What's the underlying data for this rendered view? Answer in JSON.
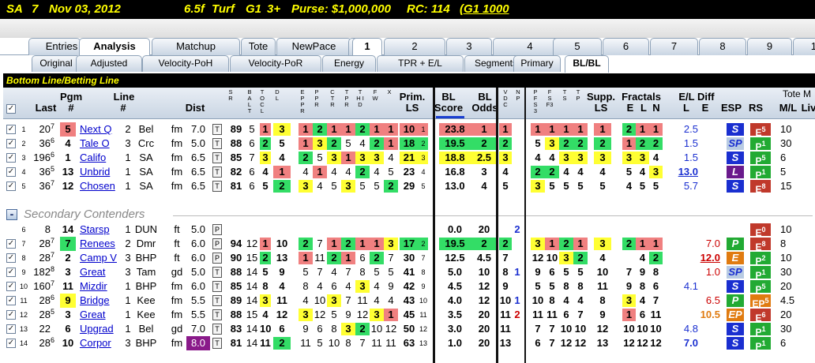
{
  "title": {
    "track": "SA",
    "race": "7",
    "date": "Nov 03, 2012",
    "distance": "6.5f",
    "surface": "Turf",
    "grade": "G1",
    "age": "3+",
    "purse": "Purse: $1,000,000",
    "rc": "RC: 114",
    "rc_suffix": "(G1 1000"
  },
  "tabs_primary": [
    "Entries",
    "Analysis",
    "Matchup",
    "Tote",
    "NewPace",
    "1",
    "2",
    "3",
    "4",
    "5",
    "6",
    "7",
    "8",
    "9",
    "10"
  ],
  "tabs_secondary": [
    "Original",
    "Adjusted",
    "Velocity-PoH",
    "Velocity-PoR",
    "Energy",
    "TPR + E/L",
    "Segments",
    "Primary",
    "BL/BL"
  ],
  "section_title": "Bottom Line/Betting Line",
  "secondary_label": "Secondary Contenders",
  "headers": {
    "last": "Last",
    "pgm": "Pgm",
    "pgm_hash": "#",
    "line": "Line",
    "line_hash": "#",
    "dist": "Dist",
    "sr": "S R",
    "balt": "B A L T",
    "tocl": "T O C L",
    "dl": "D L",
    "epp": "E P P R",
    "ppr": "P P R",
    "ctr": "C T R",
    "tpr": "T P R",
    "thd": "T H I D",
    "fw": "F W",
    "fx": "X",
    "prim": "Prim.",
    "ls": "LS",
    "bl_score": "BL Score",
    "bl_odds": "BL Odds",
    "vdc": "V D C",
    "np": "N P",
    "pfs": "P F S 3",
    "fs": "F S F3",
    "ts": "T S",
    "tp": "T P",
    "supp": "Supp.",
    "sls": "LS",
    "fractals": "Fractals",
    "e": "E",
    "l": "L",
    "n": "N",
    "eldiff": "E/L Diff",
    "el_l": "L",
    "el_e": "E",
    "esp": "ESP",
    "rs": "RS",
    "tote": "Tote M",
    "ml": "M/L",
    "live": "Liv"
  },
  "primary": [
    {
      "i": "1",
      "last": "20",
      "lsup": "7",
      "pgm": "5",
      "name": "Next Q",
      "line": "2",
      "trk": "Bel",
      "sf": "fm",
      "dist": "7.0",
      "tag": "T",
      "sr": "89",
      "b1": "5",
      "b2": "1",
      "b3": "3",
      "e1": "1",
      "e2": "2",
      "e3": "1",
      "e4": "1",
      "e5": "2",
      "e6": "1",
      "e7": "1",
      "e8": "2",
      "prim": "10",
      "pls": "1",
      "score": "23.8",
      "odds": "1",
      "vdc": "1",
      "np": "",
      "s1": "1",
      "s2": "1",
      "s3": "1",
      "s4": "1",
      "supp": "1",
      "fe": "2",
      "fl": "1",
      "fn": "1",
      "el": "2.5",
      "ee": "",
      "esp": "S",
      "rs": "E",
      "rsn": "5",
      "ml": "10",
      "live": ""
    },
    {
      "i": "2",
      "last": "36",
      "lsup": "6",
      "pgm": "4",
      "name": "Tale O",
      "line": "3",
      "trk": "Crc",
      "sf": "fm",
      "dist": "5.0",
      "tag": "T",
      "sr": "88",
      "b1": "6",
      "b2": "2",
      "b3": "5",
      "e1": "1",
      "e2": "3",
      "e3": "2",
      "e4": "5",
      "e5": "4",
      "e6": "2",
      "e7": "1",
      "e8": "",
      "prim": "18",
      "pls": "2",
      "score": "19.5",
      "odds": "2",
      "vdc": "2",
      "np": "",
      "s1": "5",
      "s2": "3",
      "s3": "2",
      "s4": "2",
      "supp": "2",
      "fe": "1",
      "fl": "2",
      "fn": "2",
      "el": "1.5",
      "ee": "",
      "esp": "SP",
      "rs": "P",
      "rsn": "1",
      "ml": "30",
      "live": ""
    },
    {
      "i": "3",
      "last": "196",
      "lsup": "6",
      "pgm": "1",
      "name": "Califo",
      "line": "1",
      "trk": "SA",
      "sf": "fm",
      "dist": "6.5",
      "tag": "T",
      "sr": "85",
      "b1": "7",
      "b2": "3",
      "b3": "4",
      "e1": "2",
      "e2": "5",
      "e3": "3",
      "e4": "1",
      "e5": "3",
      "e6": "3",
      "e7": "4",
      "e8": "",
      "prim": "21",
      "pls": "3",
      "score": "18.8",
      "odds": "2.5",
      "vdc": "3",
      "np": "",
      "s1": "4",
      "s2": "4",
      "s3": "3",
      "s4": "3",
      "supp": "3",
      "fe": "3",
      "fl": "3",
      "fn": "4",
      "el": "1.5",
      "ee": "",
      "esp": "S",
      "rs": "P",
      "rsn": "5",
      "ml": "6",
      "live": ""
    },
    {
      "i": "4",
      "last": "36",
      "lsup": "5",
      "pgm": "13",
      "name": "Unbrid",
      "line": "1",
      "trk": "SA",
      "sf": "fm",
      "dist": "6.5",
      "tag": "T",
      "sr": "82",
      "b1": "6",
      "b2": "4",
      "b3": "1",
      "e1": "4",
      "e2": "1",
      "e3": "4",
      "e4": "4",
      "e5": "2",
      "e6": "4",
      "e7": "5",
      "e8": "",
      "prim": "23",
      "pls": "4",
      "score": "16.8",
      "odds": "3",
      "vdc": "4",
      "np": "",
      "s1": "2",
      "s2": "2",
      "s3": "4",
      "s4": "4",
      "supp": "4",
      "fe": "5",
      "fl": "4",
      "fn": "3",
      "el": "13.0",
      "ee": "",
      "esp": "L",
      "rs": "P",
      "rsn": "1",
      "ml": "5",
      "live": ""
    },
    {
      "i": "5",
      "last": "36",
      "lsup": "7",
      "pgm": "12",
      "name": "Chosen",
      "line": "1",
      "trk": "SA",
      "sf": "fm",
      "dist": "6.5",
      "tag": "T",
      "sr": "81",
      "b1": "6",
      "b2": "5",
      "b3": "2",
      "e1": "3",
      "e2": "4",
      "e3": "5",
      "e4": "3",
      "e5": "5",
      "e6": "5",
      "e7": "2",
      "e8": "",
      "prim": "29",
      "pls": "5",
      "score": "13.0",
      "odds": "4",
      "vdc": "5",
      "np": "",
      "s1": "3",
      "s2": "5",
      "s3": "5",
      "s4": "5",
      "supp": "5",
      "fe": "4",
      "fl": "5",
      "fn": "5",
      "el": "5.7",
      "ee": "",
      "esp": "S",
      "rs": "E",
      "rsn": "8",
      "ml": "15",
      "live": ""
    }
  ],
  "secondary": [
    {
      "i": "6",
      "last": "8",
      "lsup": "",
      "pgm": "14",
      "name": "Starsp",
      "line": "1",
      "trk": "DUN",
      "sf": "ft",
      "dist": "5.0",
      "tag": "P",
      "sr": "",
      "b1": "",
      "b2": "",
      "b3": "",
      "e1": "",
      "e2": "",
      "e3": "",
      "e4": "",
      "e5": "",
      "e6": "",
      "e7": "",
      "e8": "",
      "prim": "",
      "pls": "",
      "score": "0.0",
      "odds": "20",
      "vdc": "",
      "np": "2",
      "s1": "",
      "s2": "",
      "s3": "",
      "s4": "",
      "supp": "",
      "fe": "",
      "fl": "",
      "fn": "",
      "el": "",
      "ee": "",
      "esp": "",
      "rs": "E",
      "rsn": "0",
      "ml": "10",
      "live": ""
    },
    {
      "i": "7",
      "last": "28",
      "lsup": "7",
      "pgm": "7",
      "name": "Renees",
      "line": "2",
      "trk": "Dmr",
      "sf": "ft",
      "dist": "6.0",
      "tag": "P",
      "sr": "94",
      "b1": "12",
      "b2": "1",
      "b3": "10",
      "e1": "2",
      "e2": "7",
      "e3": "1",
      "e4": "2",
      "e5": "1",
      "e6": "1",
      "e7": "3",
      "e8": "",
      "prim": "17",
      "pls": "2",
      "score": "19.5",
      "odds": "2",
      "vdc": "2",
      "np": "",
      "s1": "3",
      "s2": "1",
      "s3": "2",
      "s4": "1",
      "supp": "3",
      "fe": "2",
      "fl": "1",
      "fn": "1",
      "el": "",
      "ee": "7.0",
      "esp": "P",
      "rs": "E",
      "rsn": "8",
      "ml": "8",
      "live": ""
    },
    {
      "i": "8",
      "last": "28",
      "lsup": "7",
      "pgm": "2",
      "name": "Camp V",
      "line": "3",
      "trk": "BHP",
      "sf": "ft",
      "dist": "6.0",
      "tag": "P",
      "sr": "90",
      "b1": "15",
      "b2": "2",
      "b3": "13",
      "e1": "1",
      "e2": "11",
      "e3": "2",
      "e4": "1",
      "e5": "6",
      "e6": "2",
      "e7": "7",
      "e8": "",
      "prim": "30",
      "pls": "7",
      "score": "12.5",
      "odds": "4.5",
      "vdc": "7",
      "np": "",
      "s1": "12",
      "s2": "10",
      "s3": "3",
      "s4": "2",
      "supp": "4",
      "fe": "",
      "fl": "4",
      "fn": "2",
      "el": "",
      "ee": "12.0",
      "esp": "E",
      "rs": "P",
      "rsn": "2",
      "ml": "10",
      "live": ""
    },
    {
      "i": "9",
      "last": "182",
      "lsup": "8",
      "pgm": "3",
      "name": "Great",
      "line": "3",
      "trk": "Tam",
      "sf": "gd",
      "dist": "5.0",
      "tag": "T",
      "sr": "88",
      "b1": "14",
      "b2": "5",
      "b3": "9",
      "e1": "5",
      "e2": "7",
      "e3": "4",
      "e4": "7",
      "e5": "8",
      "e6": "5",
      "e7": "5",
      "e8": "",
      "prim": "41",
      "pls": "8",
      "score": "5.0",
      "odds": "10",
      "vdc": "8",
      "np": "1",
      "s1": "9",
      "s2": "6",
      "s3": "5",
      "s4": "5",
      "supp": "10",
      "fe": "7",
      "fl": "9",
      "fn": "8",
      "el": "",
      "ee": "1.0",
      "esp": "SP",
      "rs": "P",
      "rsn": "1",
      "ml": "30",
      "live": ""
    },
    {
      "i": "10",
      "last": "160",
      "lsup": "7",
      "pgm": "11",
      "name": "Mizdir",
      "line": "1",
      "trk": "BHP",
      "sf": "fm",
      "dist": "6.0",
      "tag": "T",
      "sr": "85",
      "b1": "14",
      "b2": "8",
      "b3": "4",
      "e1": "8",
      "e2": "4",
      "e3": "6",
      "e4": "4",
      "e5": "3",
      "e6": "4",
      "e7": "9",
      "e8": "8",
      "prim": "42",
      "pls": "9",
      "score": "4.5",
      "odds": "12",
      "vdc": "9",
      "np": "",
      "s1": "5",
      "s2": "5",
      "s3": "8",
      "s4": "8",
      "supp": "11",
      "fe": "9",
      "fl": "8",
      "fn": "6",
      "el": "4.1",
      "ee": "",
      "esp": "S",
      "rs": "P",
      "rsn": "5",
      "ml": "20",
      "live": ""
    },
    {
      "i": "11",
      "last": "28",
      "lsup": "6",
      "pgm": "9",
      "name": "Bridge",
      "line": "1",
      "trk": "Kee",
      "sf": "fm",
      "dist": "5.5",
      "tag": "T",
      "sr": "89",
      "b1": "14",
      "b2": "3",
      "b3": "11",
      "e1": "4",
      "e2": "10",
      "e3": "3",
      "e4": "7",
      "e5": "11",
      "e6": "4",
      "e7": "4",
      "e8": "4",
      "prim": "43",
      "pls": "10",
      "score": "4.0",
      "odds": "12",
      "vdc": "10",
      "np": "1",
      "s1": "10",
      "s2": "8",
      "s3": "4",
      "s4": "4",
      "supp": "8",
      "fe": "3",
      "fl": "4",
      "fn": "7",
      "el": "",
      "ee": "6.5",
      "esp": "P",
      "rs": "EP",
      "rsn": "5",
      "ml": "4.5",
      "live": ""
    },
    {
      "i": "12",
      "last": "28",
      "lsup": "5",
      "pgm": "3",
      "name": "Great",
      "line": "1",
      "trk": "Kee",
      "sf": "fm",
      "dist": "5.5",
      "tag": "T",
      "sr": "88",
      "b1": "15",
      "b2": "4",
      "b3": "12",
      "e1": "3",
      "e2": "12",
      "e3": "5",
      "e4": "9",
      "e5": "12",
      "e6": "3",
      "e7": "1",
      "e8": "",
      "prim": "45",
      "pls": "11",
      "score": "3.5",
      "odds": "20",
      "vdc": "11",
      "np": "2",
      "s1": "11",
      "s2": "11",
      "s3": "6",
      "s4": "7",
      "supp": "9",
      "fe": "1",
      "fl": "6",
      "fn": "11",
      "el": "",
      "ee": "10.5",
      "esp": "EP",
      "rs": "E",
      "rsn": "6",
      "ml": "20",
      "live": ""
    },
    {
      "i": "13",
      "last": "22",
      "lsup": "",
      "pgm": "6",
      "name": "Upgrad",
      "line": "1",
      "trk": "Bel",
      "sf": "gd",
      "dist": "7.0",
      "tag": "T",
      "sr": "83",
      "b1": "14",
      "b2": "10",
      "b3": "6",
      "e1": "9",
      "e2": "6",
      "e3": "8",
      "e4": "3",
      "e5": "2",
      "e6": "10",
      "e7": "12",
      "e8": "",
      "prim": "50",
      "pls": "12",
      "score": "3.0",
      "odds": "20",
      "vdc": "11",
      "np": "",
      "s1": "7",
      "s2": "7",
      "s3": "10",
      "s4": "10",
      "supp": "12",
      "fe": "10",
      "fl": "10",
      "fn": "10",
      "el": "4.8",
      "ee": "",
      "esp": "S",
      "rs": "P",
      "rsn": "1",
      "ml": "30",
      "live": ""
    },
    {
      "i": "14",
      "last": "28",
      "lsup": "6",
      "pgm": "10",
      "name": "Corpor",
      "line": "3",
      "trk": "BHP",
      "sf": "fm",
      "dist": "8.0",
      "tag": "T",
      "sr": "81",
      "b1": "14",
      "b2": "11",
      "b3": "2",
      "e1": "11",
      "e2": "5",
      "e3": "10",
      "e4": "8",
      "e5": "7",
      "e6": "11",
      "e7": "11",
      "e8": "",
      "prim": "63",
      "pls": "13",
      "score": "1.0",
      "odds": "20",
      "vdc": "13",
      "np": "",
      "s1": "6",
      "s2": "7",
      "s3": "12",
      "s4": "12",
      "supp": "13",
      "fe": "12",
      "fl": "12",
      "fn": "12",
      "el": "7.0",
      "ee": "",
      "esp": "S",
      "rs": "P",
      "rsn": "1",
      "ml": "6",
      "live": ""
    }
  ],
  "colors": {
    "green": "#33dd66",
    "yellow": "#ffff33",
    "red": "#f08080",
    "esp_blue": "#1a2fd0",
    "esp_purple": "#6a1a8c",
    "esp_green": "#22aa33",
    "esp_orange": "#e07b10",
    "dist_purple": "#8a1a8a"
  }
}
